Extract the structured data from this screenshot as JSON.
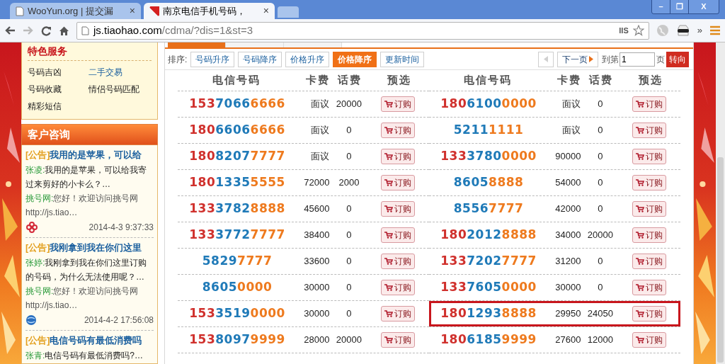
{
  "browser": {
    "tabs": [
      {
        "title": "WooYun.org | 提交漏",
        "selected": false
      },
      {
        "title": "南京电信手机号码，",
        "selected": true
      }
    ],
    "close_label": "×",
    "window_controls": {
      "minimize": "–",
      "restore": "❐",
      "close": "X"
    },
    "url": {
      "host": "js.tiaohao.com",
      "path": "/cdma/?dis=1&st=3"
    },
    "extension_label": "IIS",
    "overflow_label": "»"
  },
  "sidebar": {
    "services": {
      "title": "特色服务",
      "items": [
        {
          "label": "号码吉凶",
          "selected": false
        },
        {
          "label": "二手交易",
          "selected": true
        },
        {
          "label": "号码收藏",
          "selected": false
        },
        {
          "label": "情侣号码匹配",
          "selected": false
        },
        {
          "label": "精彩短信",
          "selected": false
        }
      ]
    },
    "consult": {
      "title": "客户咨询",
      "items": [
        {
          "tag": "[公告]",
          "title": "我用的是苹果，可以给",
          "author": "张凌:",
          "question": "我用的是苹果，可以给我寄过来剪好的小卡么？…",
          "reply_author": "挑号网:",
          "reply": "您好！欢迎访问挑号网 http://js.tiao…",
          "kind": "unicom",
          "date": "2014-4-3 9:37:33"
        },
        {
          "tag": "[公告]",
          "title": "我刚拿到我在你们这里",
          "author": "张婷:",
          "question": "我刚拿到我在你们这里订购的号码，为什么无法使用呢？…",
          "reply_author": "挑号网:",
          "reply": "您好！欢迎访问挑号网 http://js.tiao…",
          "kind": "mobile",
          "date": "2014-4-2 17:56:08"
        },
        {
          "tag": "[公告]",
          "title": "电信号码有最低消费吗",
          "author": "张青:",
          "question": "电信号码有最低消费吗?…"
        }
      ]
    }
  },
  "category_tabs": [
    {
      "selected": true
    },
    {
      "selected": false
    },
    {
      "selected": false
    }
  ],
  "sort_bar": {
    "label": "排序:",
    "options": [
      {
        "label": "号码升序",
        "selected": false
      },
      {
        "label": "号码降序",
        "selected": false
      },
      {
        "label": "价格升序",
        "selected": false
      },
      {
        "label": "价格降序",
        "selected": true
      },
      {
        "label": "更新时间",
        "selected": false
      }
    ],
    "prev_disabled": true,
    "next": "下一页",
    "goto_label": "到第",
    "page": "1",
    "page_suffix": "页",
    "go": "转向"
  },
  "table": {
    "halves": [
      {
        "columns": [
          "电信号码",
          "卡费",
          "话费",
          "预选"
        ],
        "rows": [
          {
            "number": [
              {
                "kind": "prefix",
                "text": "153"
              },
              {
                "kind": "middle",
                "text": "7066"
              },
              {
                "kind": "tail",
                "text": "6666"
              }
            ],
            "card_fee": "面议",
            "call_fee": "20000",
            "order": "订购",
            "highlighted": false
          },
          {
            "number": [
              {
                "kind": "prefix",
                "text": "180"
              },
              {
                "kind": "middle",
                "text": "6606"
              },
              {
                "kind": "tail",
                "text": "6666"
              }
            ],
            "card_fee": "面议",
            "call_fee": "0",
            "order": "订购",
            "highlighted": false
          },
          {
            "number": [
              {
                "kind": "prefix",
                "text": "180"
              },
              {
                "kind": "middle",
                "text": "8207"
              },
              {
                "kind": "tail",
                "text": "7777"
              }
            ],
            "card_fee": "面议",
            "call_fee": "0",
            "order": "订购",
            "highlighted": false
          },
          {
            "number": [
              {
                "kind": "prefix",
                "text": "180"
              },
              {
                "kind": "middle",
                "text": "1335"
              },
              {
                "kind": "tail",
                "text": "5555"
              }
            ],
            "card_fee": "72000",
            "call_fee": "2000",
            "order": "订购",
            "highlighted": false
          },
          {
            "number": [
              {
                "kind": "prefix",
                "text": "133"
              },
              {
                "kind": "middle",
                "text": "3782"
              },
              {
                "kind": "tail",
                "text": "8888"
              }
            ],
            "card_fee": "45600",
            "call_fee": "0",
            "order": "订购",
            "highlighted": false
          },
          {
            "number": [
              {
                "kind": "prefix",
                "text": "133"
              },
              {
                "kind": "middle",
                "text": "3772"
              },
              {
                "kind": "tail",
                "text": "7777"
              }
            ],
            "card_fee": "38400",
            "call_fee": "0",
            "order": "订购",
            "highlighted": false
          },
          {
            "number": [
              {
                "kind": "middle",
                "text": "5829"
              },
              {
                "kind": "tail",
                "text": "7777"
              }
            ],
            "card_fee": "33600",
            "call_fee": "0",
            "order": "订购",
            "highlighted": false
          },
          {
            "number": [
              {
                "kind": "middle",
                "text": "8605"
              },
              {
                "kind": "tail",
                "text": "0000"
              }
            ],
            "card_fee": "30000",
            "call_fee": "0",
            "order": "订购",
            "highlighted": false
          },
          {
            "number": [
              {
                "kind": "prefix",
                "text": "153"
              },
              {
                "kind": "middle",
                "text": "3519"
              },
              {
                "kind": "tail",
                "text": "0000"
              }
            ],
            "card_fee": "30000",
            "call_fee": "0",
            "order": "订购",
            "highlighted": false
          },
          {
            "number": [
              {
                "kind": "prefix",
                "text": "153"
              },
              {
                "kind": "middle",
                "text": "8097"
              },
              {
                "kind": "tail",
                "text": "9999"
              }
            ],
            "card_fee": "28000",
            "call_fee": "20000",
            "order": "订购",
            "highlighted": false
          }
        ]
      },
      {
        "columns": [
          "电信号码",
          "卡费",
          "话费",
          "预选"
        ],
        "rows": [
          {
            "number": [
              {
                "kind": "prefix",
                "text": "180"
              },
              {
                "kind": "middle",
                "text": "6100"
              },
              {
                "kind": "tail",
                "text": "0000"
              }
            ],
            "card_fee": "面议",
            "call_fee": "0",
            "order": "订购",
            "highlighted": false
          },
          {
            "number": [
              {
                "kind": "middle",
                "text": "5211"
              },
              {
                "kind": "tail",
                "text": "1111"
              }
            ],
            "card_fee": "面议",
            "call_fee": "0",
            "order": "订购",
            "highlighted": false
          },
          {
            "number": [
              {
                "kind": "prefix",
                "text": "133"
              },
              {
                "kind": "middle",
                "text": "3780"
              },
              {
                "kind": "tail",
                "text": "0000"
              }
            ],
            "card_fee": "90000",
            "call_fee": "0",
            "order": "订购",
            "highlighted": false
          },
          {
            "number": [
              {
                "kind": "middle",
                "text": "8605"
              },
              {
                "kind": "tail",
                "text": "8888"
              }
            ],
            "card_fee": "54000",
            "call_fee": "0",
            "order": "订购",
            "highlighted": false
          },
          {
            "number": [
              {
                "kind": "middle",
                "text": "8556"
              },
              {
                "kind": "tail",
                "text": "7777"
              }
            ],
            "card_fee": "42000",
            "call_fee": "0",
            "order": "订购",
            "highlighted": false
          },
          {
            "number": [
              {
                "kind": "prefix",
                "text": "180"
              },
              {
                "kind": "middle",
                "text": "2012"
              },
              {
                "kind": "tail",
                "text": "8888"
              }
            ],
            "card_fee": "34000",
            "call_fee": "20000",
            "order": "订购",
            "highlighted": false
          },
          {
            "number": [
              {
                "kind": "prefix",
                "text": "133"
              },
              {
                "kind": "middle",
                "text": "7202"
              },
              {
                "kind": "tail",
                "text": "7777"
              }
            ],
            "card_fee": "31200",
            "call_fee": "0",
            "order": "订购",
            "highlighted": false
          },
          {
            "number": [
              {
                "kind": "prefix",
                "text": "133"
              },
              {
                "kind": "middle",
                "text": "7605"
              },
              {
                "kind": "tail",
                "text": "0000"
              }
            ],
            "card_fee": "30000",
            "call_fee": "0",
            "order": "订购",
            "highlighted": false
          },
          {
            "number": [
              {
                "kind": "prefix",
                "text": "180"
              },
              {
                "kind": "middle",
                "text": "1293"
              },
              {
                "kind": "tail",
                "text": "8888"
              }
            ],
            "card_fee": "29950",
            "call_fee": "24050",
            "order": "订购",
            "highlighted": true
          },
          {
            "number": [
              {
                "kind": "prefix",
                "text": "180"
              },
              {
                "kind": "middle",
                "text": "6185"
              },
              {
                "kind": "tail",
                "text": "9999"
              }
            ],
            "card_fee": "27600",
            "call_fee": "12000",
            "order": "订购",
            "highlighted": false
          }
        ]
      }
    ]
  }
}
